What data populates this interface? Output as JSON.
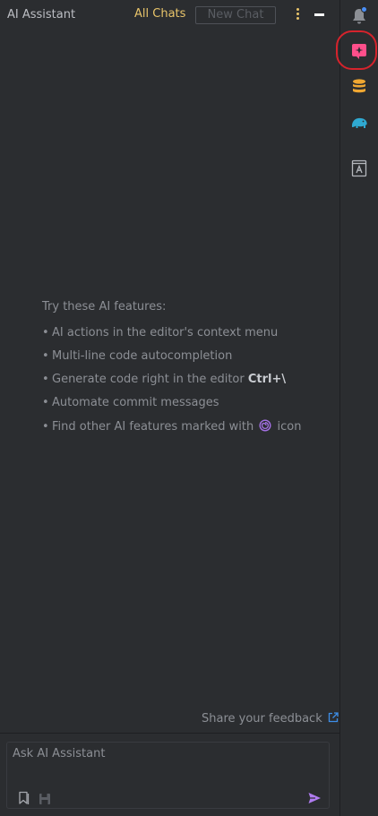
{
  "header": {
    "title": "AI Assistant",
    "all_chats_label": "All Chats",
    "new_chat_label": "New Chat"
  },
  "features": {
    "heading": "Try these AI features:",
    "items": [
      "AI actions in the editor's context menu",
      "Multi-line code autocompletion",
      "Generate code right in the editor",
      "Automate commit messages",
      "Find other AI features marked with"
    ],
    "shortcut": "Ctrl+\\",
    "icon_suffix": "icon"
  },
  "footer": {
    "feedback_label": "Share your feedback"
  },
  "input": {
    "placeholder": "Ask AI Assistant",
    "value": ""
  },
  "right_toolbar": {
    "items": [
      "notifications-icon",
      "ai-assistant-icon",
      "database-icon",
      "gradle-elephant-icon",
      "dictionary-icon"
    ]
  },
  "colors": {
    "background": "#2b2d30",
    "accent_yellow": "#e8c46a",
    "ai_pink": "#ff4f8b",
    "ai_purple": "#a571e6",
    "send_purple": "#b07cf0",
    "link_blue": "#3d8ee8",
    "highlight_red": "#d6232c",
    "database_orange": "#f0a732",
    "elephant_teal": "#2fa9d1",
    "notification_dot": "#4a8ff7"
  }
}
